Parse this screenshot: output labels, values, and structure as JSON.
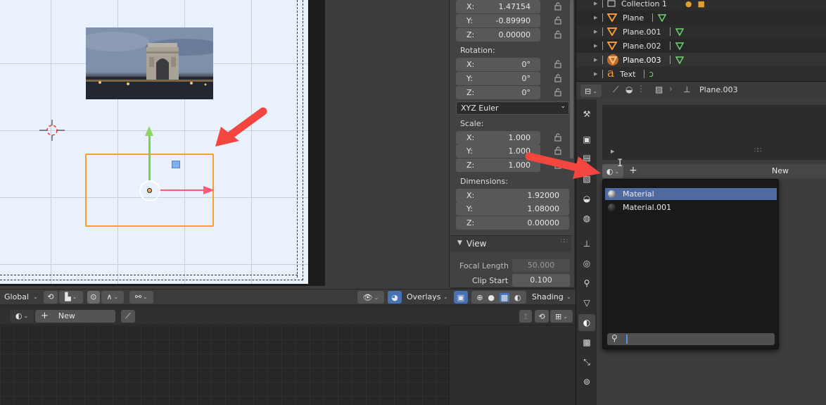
{
  "colors": {
    "accent_blue": "#4f6aa1",
    "selection_orange": "#f5a033",
    "annotation_red": "#f2463f",
    "mesh_green": "#7fcc52"
  },
  "viewport_header": {
    "orientation": "Global",
    "overlays": "Overlays",
    "shading": "Shading"
  },
  "node_header": {
    "new_label": "New"
  },
  "npanel": {
    "location": {
      "x_label": "X:",
      "x": "1.47154",
      "y_label": "Y:",
      "y": "-0.89990",
      "z_label": "Z:",
      "z": "0.00000"
    },
    "rotation": {
      "title": "Rotation:",
      "x_label": "X:",
      "x": "0°",
      "y_label": "Y:",
      "y": "0°",
      "z_label": "Z:",
      "z": "0°"
    },
    "rotation_mode": "XYZ Euler",
    "scale": {
      "title": "Scale:",
      "x_label": "X:",
      "x": "1.000",
      "y_label": "Y:",
      "y": "1.000",
      "z_label": "Z:",
      "z": "1.000"
    },
    "dimensions": {
      "title": "Dimensions:",
      "x_label": "X:",
      "x": "1.92000",
      "y_label": "Y:",
      "y": "1.08000",
      "z_label": "Z:",
      "z": "0.00000"
    },
    "view": {
      "title": "View",
      "focal_length_label": "Focal Length",
      "focal_length": "50.000",
      "clip_start_label": "Clip Start",
      "clip_start": "0.100"
    }
  },
  "outliner": {
    "rows": [
      {
        "name": "Collection 1",
        "icon": "collection-icon"
      },
      {
        "name": "Plane",
        "icon": "mesh-icon"
      },
      {
        "name": "Plane.001",
        "icon": "mesh-icon"
      },
      {
        "name": "Plane.002",
        "icon": "mesh-icon"
      },
      {
        "name": "Plane.003",
        "icon": "mesh-icon",
        "selected": true
      },
      {
        "name": "Text",
        "icon": "text-icon"
      }
    ]
  },
  "properties": {
    "breadcrumb_object": "Plane.003",
    "new_label": "New",
    "material_popup": {
      "items": [
        {
          "name": "Material",
          "selected": true
        },
        {
          "name": "Material.001",
          "selected": false
        }
      ],
      "search_value": ""
    }
  }
}
